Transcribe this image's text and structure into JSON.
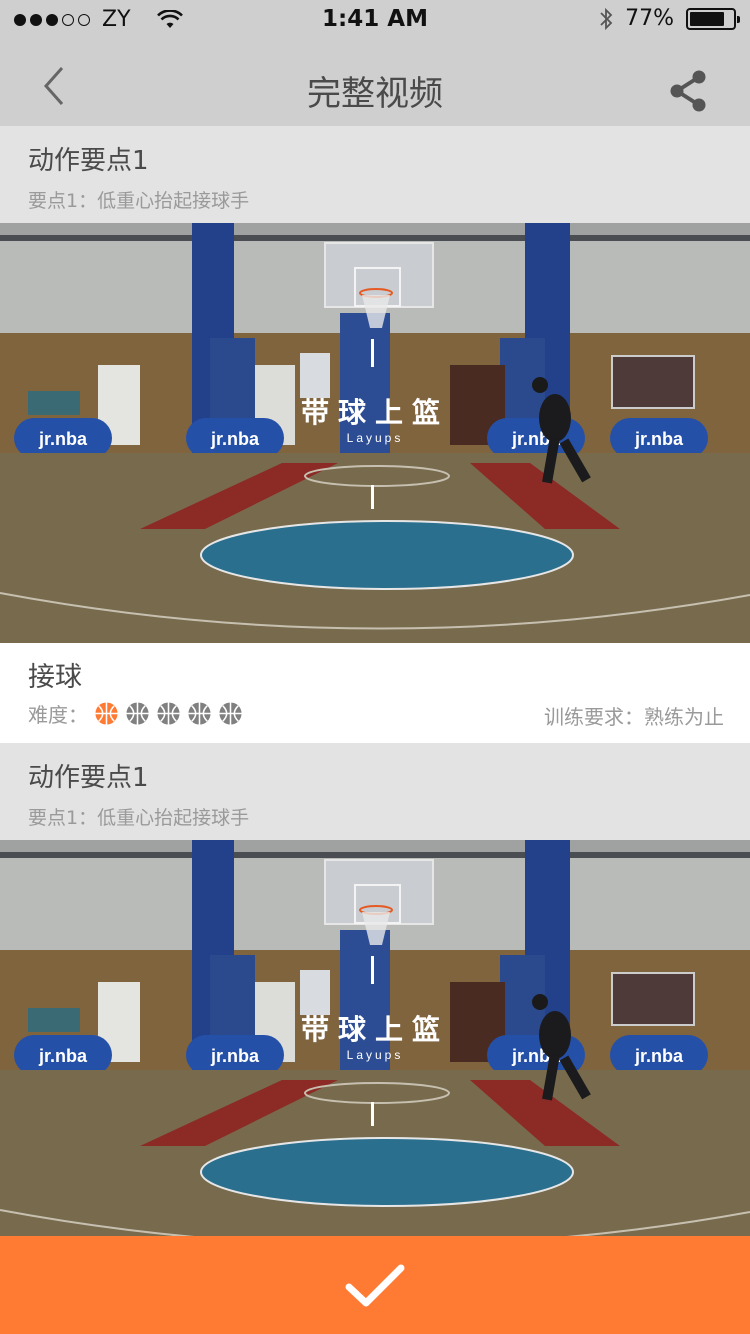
{
  "status_bar": {
    "carrier": "ZY",
    "time": "1:41 AM",
    "battery": "77%"
  },
  "nav": {
    "title": "完整视频",
    "back_icon": "chevron-left-icon",
    "share_icon": "share-icon"
  },
  "sections": [
    {
      "heading": "动作要点1",
      "subheading": "要点1：低重心抬起接球手"
    },
    {
      "heading": "动作要点1",
      "subheading": "要点1：低重心抬起接球手"
    }
  ],
  "video": {
    "title_cn": "带球上篮",
    "title_en": "Layups",
    "banner_text": "jr.nba"
  },
  "drill": {
    "name": "接球",
    "difficulty_label": "难度：",
    "difficulty_level": 1,
    "difficulty_max": 5,
    "requirement": "训练要求：熟练为止"
  },
  "colors": {
    "accent": "#ff7a33",
    "header_bg": "#cfcfcf",
    "section_bg": "#e3e3e3"
  },
  "confirm_icon": "checkmark-icon"
}
